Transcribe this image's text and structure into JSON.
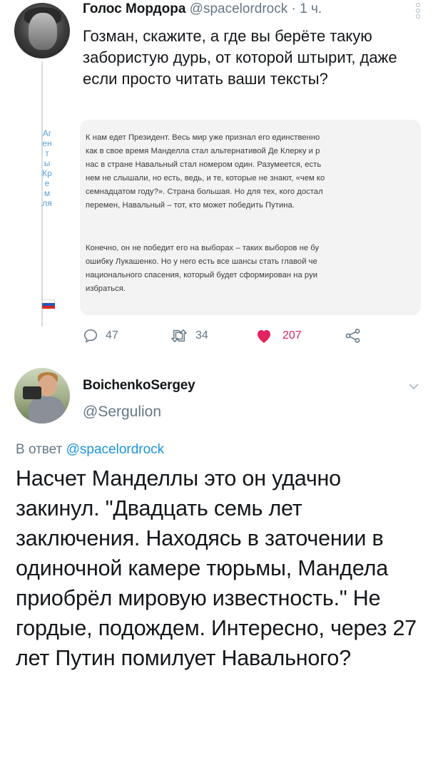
{
  "tweet1": {
    "author_name": "Голос Мордора",
    "handle": "@spacelordrock",
    "separator": "·",
    "time": "1 ч.",
    "text": "Гозман, скажите, а где вы берёте такую забористую дурь, от которой штырит, даже если просто читать ваши тексты?",
    "side_text": "Агенты Кремля",
    "quoted_image": {
      "paragraph1": [
        "К нам едет Президент. Весь мир уже признал его единственно",
        "как в свое время Манделла стал альтернативой Де Клерку и р",
        "нас в стране Навальный стал номером один. Разумеется, есть",
        "нем не слышали, но есть, ведь, и те, которые не знают, «чем ко",
        "семнадцатом году?». Страна большая. Но для тех, кого достал",
        "перемен, Навальный – тот, кто может победить Путина."
      ],
      "paragraph2": [
        "Конечно, он не победит его на выборах – таких выборов не бу",
        "ошибку Лукашенко. Но у него есть все шансы стать главой че",
        "национального спасения, который будет сформирован на руи",
        "избраться."
      ]
    },
    "actions": {
      "reply_count": "47",
      "retweet_count": "34",
      "like_count": "207"
    }
  },
  "tweet2": {
    "author_name": "BoichenkoSergey",
    "handle": "@Sergulion",
    "reply_prefix": "В ответ",
    "reply_mention": "@spacelordrock",
    "text": "Насчет Манделлы это он удачно закинул. \"Двадцать семь лет заключения. Находясь в заточении в одиночной камере тюрьмы, Мандела приобрёл мировую известность.\" Не гордые, подождем. Интересно, через 27 лет Путин помилует Навального?"
  },
  "colors": {
    "link": "#1b95e0",
    "secondary_text": "#657786",
    "like": "#e0245e",
    "side_text": "#5aa0d8"
  },
  "icons": [
    "reply-icon",
    "retweet-icon",
    "heart-icon",
    "share-icon",
    "more-icon",
    "chevron-down-icon"
  ]
}
